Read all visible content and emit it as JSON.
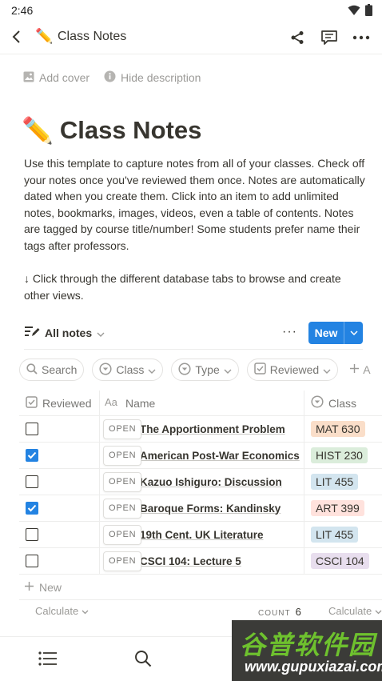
{
  "status_bar": {
    "time": "2:46"
  },
  "app_bar": {
    "emoji": "✏️",
    "title": "Class Notes"
  },
  "page_actions": {
    "add_cover": "Add cover",
    "hide_description": "Hide description"
  },
  "page": {
    "emoji": "✏️",
    "title": "Class Notes",
    "description": "Use this template to capture notes from all of your classes. Check off your notes once you've reviewed them once. Notes are automatically dated when you create them. Click into an item to add unlimited notes, bookmarks, images, videos, even a table of contents. Notes are tagged by course title/number! Some students prefer name their tags after professors.",
    "hint": "↓ Click through the different database tabs to browse and create other views."
  },
  "database": {
    "view_label": "All notes",
    "more": "···",
    "new_label": "New",
    "filters": {
      "search": "Search",
      "class": "Class",
      "type": "Type",
      "reviewed": "Reviewed",
      "add": "A"
    },
    "columns": {
      "reviewed": "Reviewed",
      "name": "Name",
      "class": "Class"
    },
    "open_label": "OPEN",
    "rows": [
      {
        "reviewed": false,
        "name": "The Apportionment Problem",
        "class": "MAT 630"
      },
      {
        "reviewed": true,
        "name": "American Post-War Economics",
        "class": "HIST 230"
      },
      {
        "reviewed": false,
        "name": "Kazuo Ishiguro: Discussion",
        "class": "LIT 455"
      },
      {
        "reviewed": true,
        "name": "Baroque Forms: Kandinsky",
        "class": "ART 399"
      },
      {
        "reviewed": false,
        "name": "19th Cent. UK Literature",
        "class": "LIT 455"
      },
      {
        "reviewed": false,
        "name": "CSCI 104: Lecture 5",
        "class": "CSCI 104"
      }
    ],
    "add_row_label": "New",
    "calculate_left": "Calculate",
    "count_label": "COUNT",
    "count_value": "6",
    "calculate_right": "Calculate"
  },
  "tag_colors": {
    "MAT 630": "#fadec9",
    "HIST 230": "#dbeddb",
    "LIT 455": "#d3e5ef",
    "ART 399": "#ffe2dd",
    "CSCI 104": "#e8deee"
  },
  "accent_color": "#2383e2",
  "watermark": {
    "title": "谷普软件园",
    "url": "www.gupuxiazai.com"
  }
}
